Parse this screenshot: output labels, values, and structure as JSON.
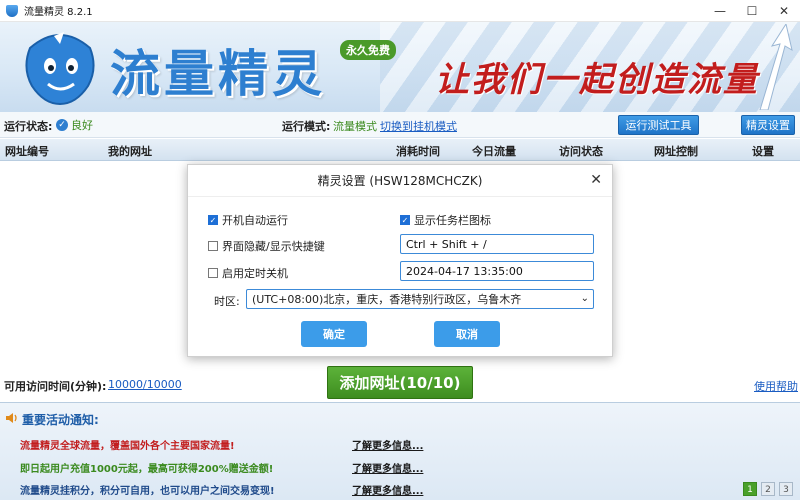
{
  "window": {
    "title": "流量精灵 8.2.1",
    "min": "—",
    "max": "☐",
    "close": "✕"
  },
  "banner": {
    "brand": "流量精灵",
    "badge": "永久免费",
    "slogan": "让我们一起创造流量"
  },
  "status": {
    "state_label": "运行状态:",
    "state_value": "良好",
    "mode_label": "运行模式:",
    "mode_value": "流量模式",
    "mode_switch": "切换到挂机模式",
    "test_button": "运行测试工具",
    "settings_button": "精灵设置"
  },
  "table": {
    "columns": [
      "网址编号",
      "我的网址",
      "消耗时间",
      "今日流量",
      "访问状态",
      "网址控制",
      "设置"
    ]
  },
  "bottom": {
    "avail_label": "可用访问时间(分钟):",
    "avail_value": "10000/10000",
    "add_button": "添加网址(10/10)",
    "help_link": "使用帮助"
  },
  "notice": {
    "title": "重要活动通知:",
    "items": [
      {
        "text": "流量精灵全球流量，覆盖国外各个主要国家流量!",
        "link": "了解更多信息...",
        "color": "#c21d1d"
      },
      {
        "text": "即日起用户充值1000元起，最高可获得200%赠送金额!",
        "link": "了解更多信息...",
        "color": "#3a8a1e"
      },
      {
        "text": "流量精灵挂积分，积分可自用，也可以用户之间交易变现!",
        "link": "了解更多信息...",
        "color": "#1f4a8a"
      }
    ],
    "pages": [
      "1",
      "2",
      "3"
    ]
  },
  "dialog": {
    "title": "精灵设置 (HSW128MCHCZK)",
    "close": "✕",
    "auto_run": "开机自动运行",
    "show_tray": "显示任务栏图标",
    "hotkey_label": "界面隐藏/显示快捷键",
    "hotkey_value": "Ctrl + Shift + /",
    "shutdown_label": "启用定时关机",
    "shutdown_value": "2024-04-17 13:35:00",
    "tz_label": "时区:",
    "tz_value": "(UTC+08:00)北京，重庆，香港特别行政区，乌鲁木齐",
    "ok": "确定",
    "cancel": "取消"
  }
}
